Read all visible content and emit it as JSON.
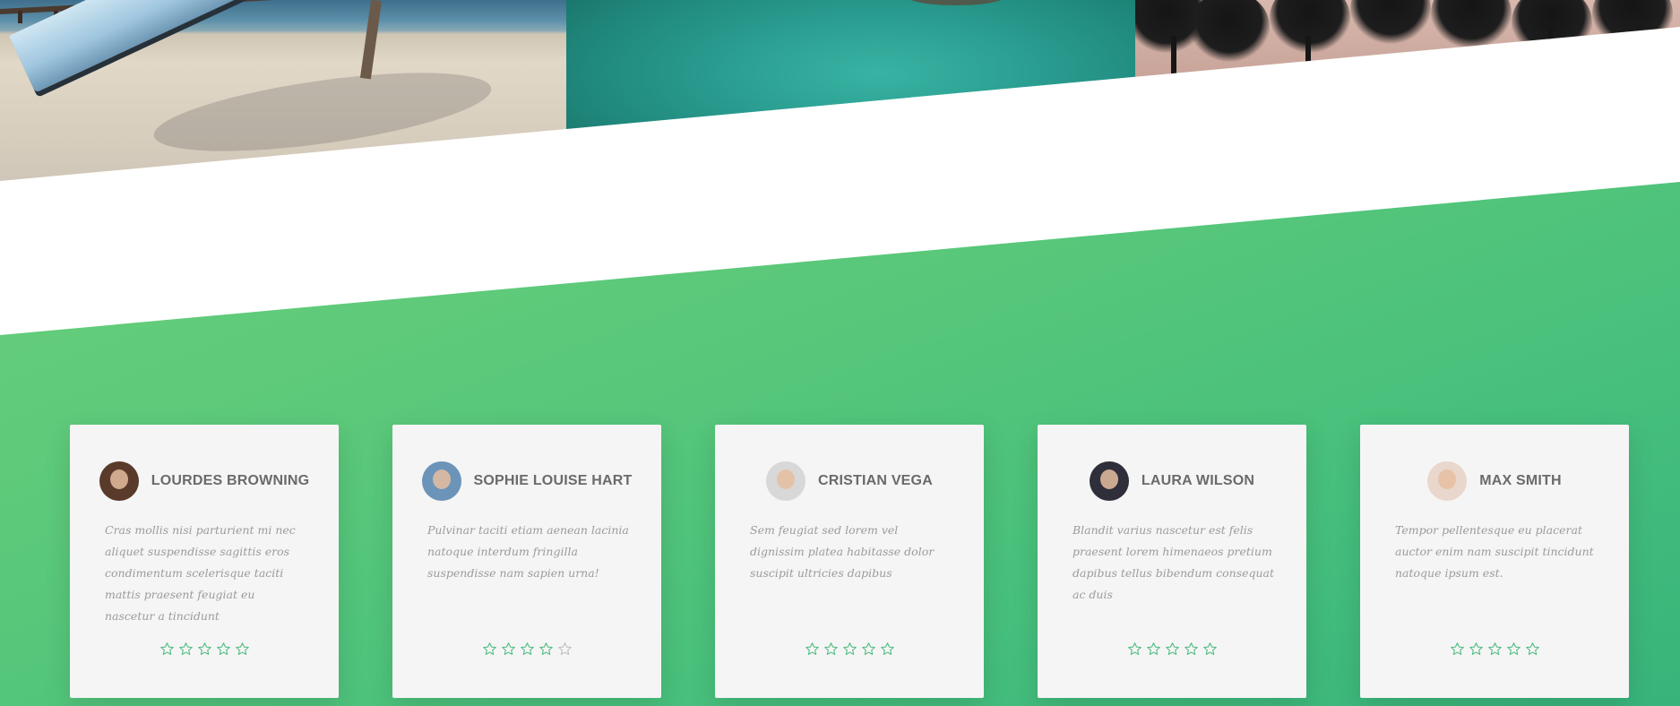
{
  "gallery": {
    "photos": [
      {
        "name": "beach-canoe-photo"
      },
      {
        "name": "turquoise-lagoon-photo"
      },
      {
        "name": "palm-trees-photo"
      }
    ]
  },
  "colors": {
    "accent_green": "#4cbb7e",
    "band_light": "#6dd27a",
    "band_dark": "#38b47b",
    "card_bg": "#f5f5f5",
    "star_off": "#bdbdbd"
  },
  "testimonials": [
    {
      "name": "LOURDES BROWNING",
      "quote": "Cras mollis nisi parturient mi nec aliquet suspendisse sagittis eros condimentum scelerisque taciti mattis praesent feugiat eu nascetur a tincidunt",
      "rating": 5,
      "rating_max": 5,
      "avatar_color": "#5a3a2a"
    },
    {
      "name": "SOPHIE LOUISE HART",
      "quote": "Pulvinar taciti etiam aenean lacinia natoque interdum fringilla suspendisse nam sapien urna!",
      "rating": 4,
      "rating_max": 5,
      "avatar_color": "#6c93b8"
    },
    {
      "name": "CRISTIAN VEGA",
      "quote": "Sem feugiat sed lorem vel dignissim platea habitasse dolor suscipit ultricies dapibus",
      "rating": 5,
      "rating_max": 5,
      "avatar_color": "#d8d8d8"
    },
    {
      "name": "LAURA WILSON",
      "quote": "Blandit varius nascetur est felis praesent lorem himenaeos pretium dapibus tellus bibendum consequat ac duis",
      "rating": 5,
      "rating_max": 5,
      "avatar_color": "#2e2f3a"
    },
    {
      "name": "MAX SMITH",
      "quote": "Tempor pellentesque eu placerat auctor enim nam suscipit tincidunt natoque ipsum est.",
      "rating": 5,
      "rating_max": 5,
      "avatar_color": "#e9d6cc"
    }
  ]
}
